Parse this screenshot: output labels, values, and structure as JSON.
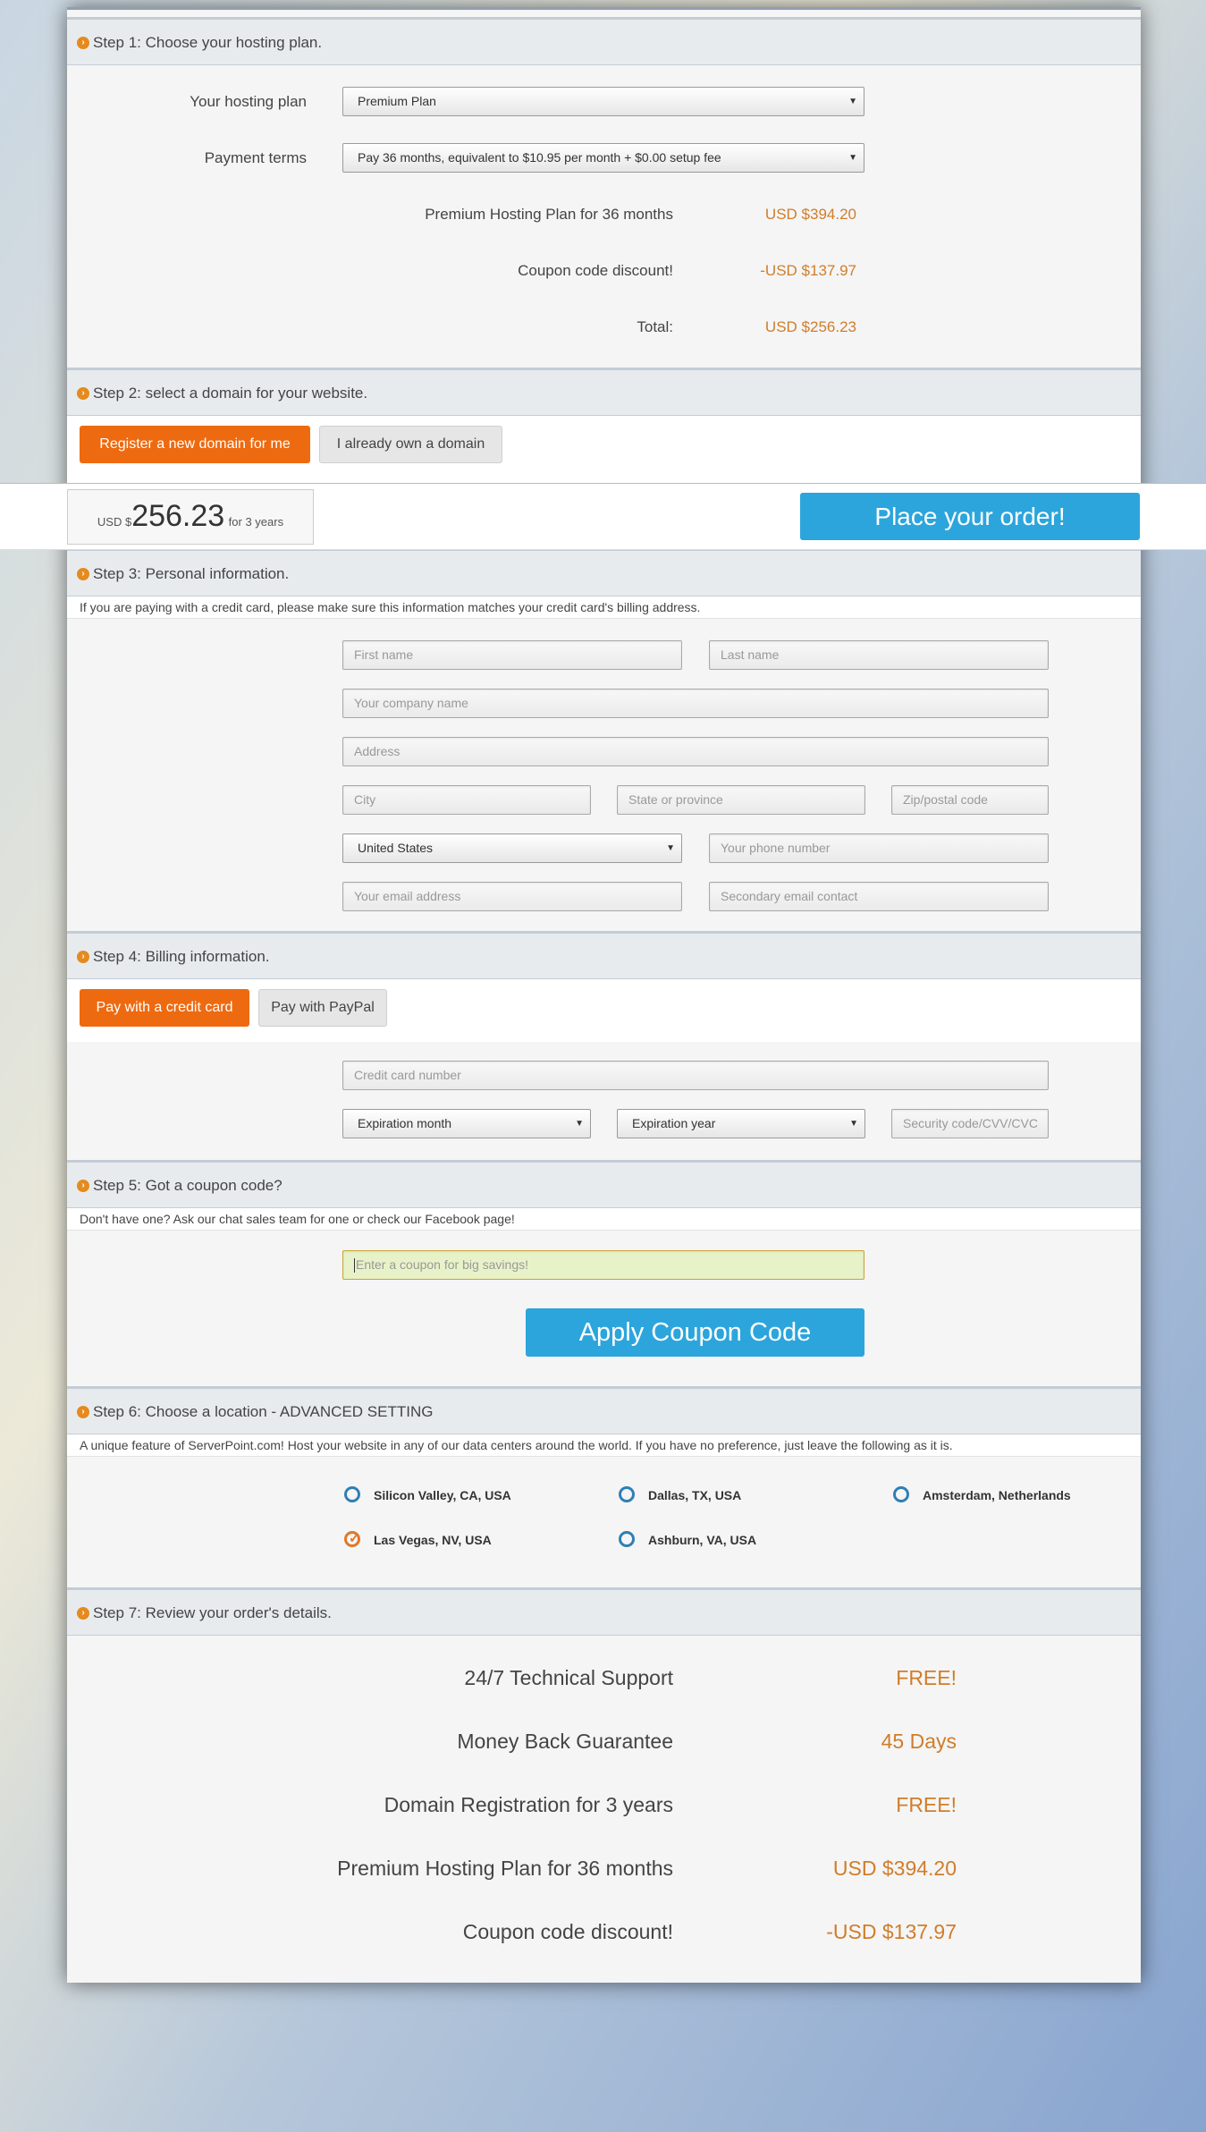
{
  "step1": {
    "title": "Step 1: Choose your hosting plan.",
    "plan_label": "Your hosting plan",
    "plan_value": "Premium Plan",
    "terms_label": "Payment terms",
    "terms_value": "Pay 36 months, equivalent to $10.95 per month + $0.00 setup fee",
    "line1_label": "Premium Hosting Plan for 36 months",
    "line1_value": "USD $394.20",
    "line2_label": "Coupon code discount!",
    "line2_value": "-USD $137.97",
    "total_label": "Total:",
    "total_value": "USD $256.23"
  },
  "step2": {
    "title": "Step 2: select a domain for your website.",
    "btn_register": "Register a new domain for me",
    "btn_own": "I already own a domain"
  },
  "sticky": {
    "currency": "USD $",
    "amount": "256.23",
    "period": "for 3 years",
    "order_button": "Place your order!"
  },
  "step3": {
    "title": "Step 3: Personal information.",
    "note": "If you are paying with a credit card, please make sure this information matches your credit card's billing address.",
    "first_name": "First name",
    "last_name": "Last name",
    "company": "Your company name",
    "address": "Address",
    "city": "City",
    "state": "State or province",
    "zip": "Zip/postal code",
    "country": "United States",
    "phone": "Your phone number",
    "email": "Your email address",
    "email2": "Secondary email contact"
  },
  "step4": {
    "title": "Step 4: Billing information.",
    "btn_card": "Pay with a credit card",
    "btn_paypal": "Pay with PayPal",
    "card_number": "Credit card number",
    "exp_month": "Expiration month",
    "exp_year": "Expiration year",
    "cvv": "Security code/CVV/CVC"
  },
  "step5": {
    "title": "Step 5: Got a coupon code?",
    "note": "Don't have one? Ask our chat sales team for one or check our Facebook page!",
    "coupon_placeholder": "Enter a coupon for big savings!",
    "apply_button": "Apply Coupon Code"
  },
  "step6": {
    "title": "Step 6: Choose a location - ADVANCED SETTING",
    "note": "A unique feature of ServerPoint.com! Host your website in any of our data centers around the world. If you have no preference, just leave the following as it is.",
    "locations": [
      {
        "label": "Silicon Valley, CA, USA",
        "selected": false
      },
      {
        "label": "Dallas, TX, USA",
        "selected": false
      },
      {
        "label": "Amsterdam, Netherlands",
        "selected": false
      },
      {
        "label": "Las Vegas, NV, USA",
        "selected": true
      },
      {
        "label": "Ashburn, VA, USA",
        "selected": false
      }
    ]
  },
  "step7": {
    "title": "Step 7: Review your order's details.",
    "rows": [
      {
        "label": "24/7 Technical Support",
        "value": "FREE!"
      },
      {
        "label": "Money Back Guarantee",
        "value": "45 Days"
      },
      {
        "label": "Domain Registration for 3 years",
        "value": "FREE!"
      },
      {
        "label": "Premium Hosting Plan for 36 months",
        "value": "USD $394.20"
      },
      {
        "label": "Coupon code discount!",
        "value": "-USD $137.97"
      }
    ]
  },
  "colors": {
    "accent_orange": "#ee6a10",
    "price_orange": "#d07d2a",
    "button_blue": "#2ca5dc"
  }
}
